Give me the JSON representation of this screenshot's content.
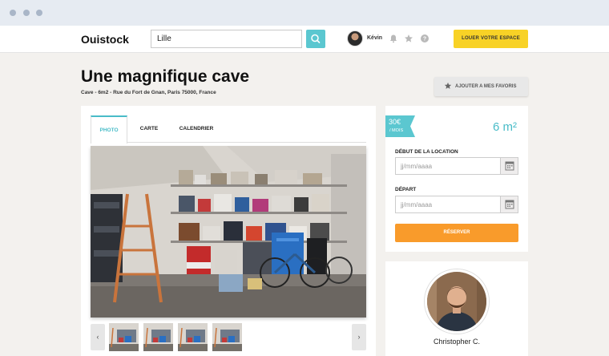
{
  "header": {
    "logo": "Ouistock",
    "search_value": "Lille",
    "user_name": "Kévin",
    "cta_label": "LOUER VOTRE ESPACE"
  },
  "listing": {
    "title": "Une magnifique cave",
    "address": "Cave - 6m2 - Rue du Fort de Gnan, Paris 75000, France",
    "favorite_label": "AJOUTER A MES FAVORIS"
  },
  "tabs": [
    {
      "label": "PHOTO",
      "active": true
    },
    {
      "label": "CARTE",
      "active": false
    },
    {
      "label": "CALENDRIER",
      "active": false
    }
  ],
  "gallery": {
    "prev": "‹",
    "next": "›",
    "thumb_count": 4
  },
  "booking": {
    "price": "30€",
    "price_unit": "/ MOIS",
    "area": "6 m²",
    "start_label": "DÉBUT DE LA LOCATION",
    "start_placeholder": "jj/mm/aaaa",
    "end_label": "DÉPART",
    "end_placeholder": "jj/mm/aaaa",
    "reserve_label": "RÉSERVER"
  },
  "host": {
    "name": "Christopher C."
  },
  "colors": {
    "accent": "#49bcc8",
    "cta": "#f8d226",
    "reserve": "#f99b2b"
  }
}
